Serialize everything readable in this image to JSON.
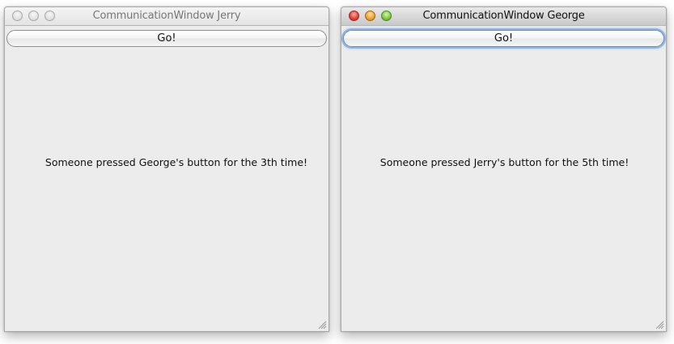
{
  "windows": {
    "jerry": {
      "title": "CommunicationWindow Jerry",
      "button_label": "Go!",
      "message": "Someone pressed George's button for the 3th time!",
      "active": false
    },
    "george": {
      "title": "CommunicationWindow George",
      "button_label": "Go!",
      "message": "Someone pressed Jerry's button for the 5th time!",
      "active": true
    }
  },
  "colors": {
    "window_background": "#ececec",
    "close_light": "#e2433a",
    "minimize_light": "#f0a533",
    "zoom_light": "#7fcb43",
    "focus_ring": "#8fb4de"
  },
  "icons": {
    "close": "close-icon",
    "minimize": "minimize-icon",
    "zoom": "zoom-icon",
    "resize": "resize-grip-icon"
  }
}
